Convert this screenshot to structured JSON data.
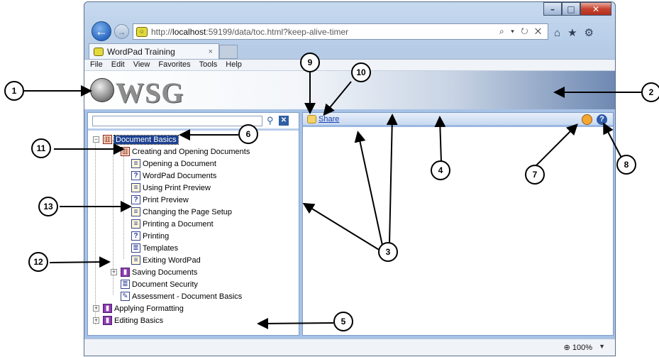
{
  "browser": {
    "url_prefix": "http://",
    "url_host": "localhost",
    "url_rest": ":59199/data/toc.html?keep-alive-timer",
    "addr_tools": "⌕ ▾ ↻ ✕",
    "tab_title": "WordPad Training",
    "tab_close": "×",
    "zoom_label": "100%"
  },
  "menu": [
    "File",
    "Edit",
    "View",
    "Favorites",
    "Tools",
    "Help"
  ],
  "banner": {
    "logo_text": "WSG"
  },
  "toolbar": {
    "share_label": "Share"
  },
  "tree": [
    {
      "label": "Document Basics"
    },
    {
      "label": "Creating and Opening Documents"
    },
    {
      "label": "Opening a Document"
    },
    {
      "label": "WordPad Documents"
    },
    {
      "label": "Using Print Preview"
    },
    {
      "label": "Print Preview"
    },
    {
      "label": "Changing the Page Setup"
    },
    {
      "label": "Printing a Document"
    },
    {
      "label": "Printing"
    },
    {
      "label": "Templates"
    },
    {
      "label": "Exiting WordPad"
    },
    {
      "label": "Saving Documents"
    },
    {
      "label": "Document Security"
    },
    {
      "label": "Assessment - Document Basics"
    },
    {
      "label": "Applying Formatting"
    },
    {
      "label": "Editing Basics"
    }
  ],
  "callouts": [
    "1",
    "2",
    "3",
    "4",
    "5",
    "6",
    "7",
    "8",
    "9",
    "10",
    "11",
    "12",
    "13"
  ]
}
